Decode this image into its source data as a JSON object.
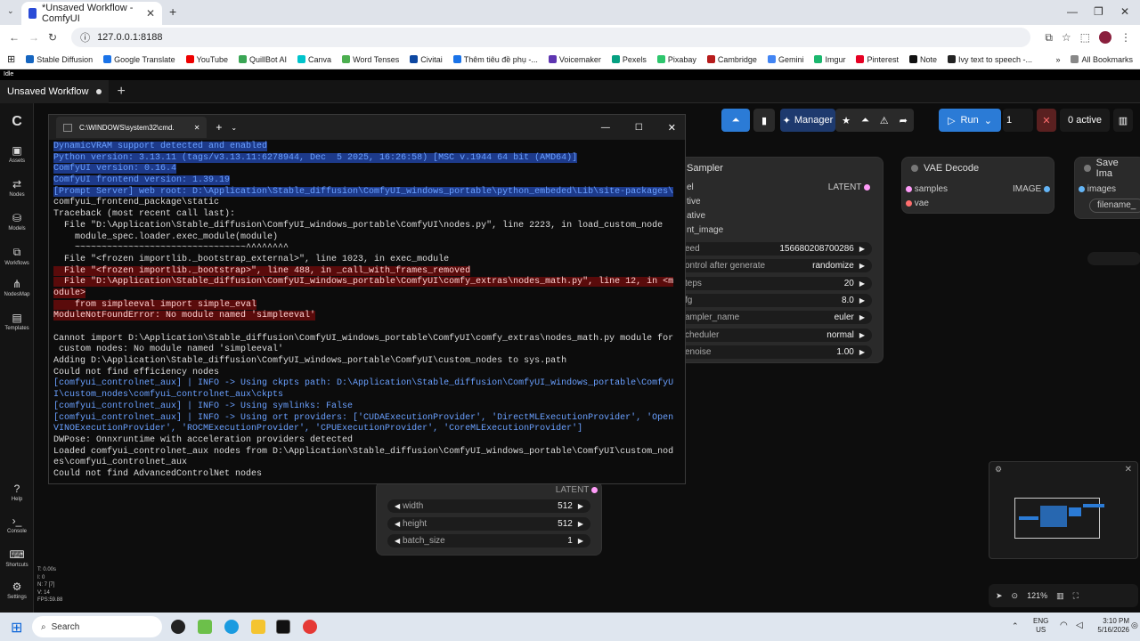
{
  "browser": {
    "tab_title": "*Unsaved Workflow - ComfyUI",
    "url": "127.0.0.1:8188",
    "bookmarks": [
      "Stable Diffusion",
      "Google Translate",
      "YouTube",
      "QuillBot AI",
      "Canva",
      "Word Tenses",
      "Civitai",
      "Thêm tiêu đề phụ -...",
      "Voicemaker",
      "Pexels",
      "Pixabay",
      "Cambridge",
      "Gemini",
      "Imgur",
      "Pinterest",
      "Note",
      "Ivy text to speech -..."
    ],
    "all_bookmarks": "All Bookmarks",
    "status": "Idle"
  },
  "comfy": {
    "workflow_tab": "Unsaved Workflow",
    "sidebar": [
      "Assets",
      "Nodes",
      "Models",
      "Workflows",
      "NodesMap",
      "Templates"
    ],
    "sidebar_bottom": [
      "Help",
      "Console",
      "Shortcuts",
      "Settings"
    ],
    "topbar": {
      "manager": "Manager",
      "run": "Run",
      "queue_count": "1",
      "active": "0 active"
    },
    "ksampler": {
      "title": "Sampler",
      "outputs": "LATENT",
      "inputs": [
        "el",
        "tive",
        "ative",
        "nt_image"
      ],
      "widgets": [
        {
          "label": "eed",
          "value": "156680208700286"
        },
        {
          "label": "ontrol after generate",
          "value": "randomize"
        },
        {
          "label": "teps",
          "value": "20"
        },
        {
          "label": "fg",
          "value": "8.0"
        },
        {
          "label": "ampler_name",
          "value": "euler"
        },
        {
          "label": "cheduler",
          "value": "normal"
        },
        {
          "label": "enoise",
          "value": "1.00"
        }
      ]
    },
    "vae_decode": {
      "title": "VAE Decode",
      "in1": "samples",
      "in2": "vae",
      "out": "IMAGE"
    },
    "save_image": {
      "title": "Save Ima",
      "in1": "images",
      "widget": "filename_"
    },
    "latent_node": {
      "out": "LATENT",
      "widgets": [
        {
          "label": "width",
          "value": "512"
        },
        {
          "label": "height",
          "value": "512"
        },
        {
          "label": "batch_size",
          "value": "1"
        }
      ]
    },
    "zoom": "121%",
    "stats": [
      "T: 0.00s",
      "I: 0",
      "N: 7 [7]",
      "V: 14",
      "FPS:59.88"
    ]
  },
  "terminal": {
    "title": "C:\\WINDOWS\\system32\\cmd.",
    "lines": [
      {
        "t": "DynamicVRAM support detected and enabled",
        "c": "blue",
        "s": "sel"
      },
      {
        "t": "Python version: 3.13.11 (tags/v3.13.11:6278944, Dec  5 2025, 16:26:58) [MSC v.1944 64 bit (AMD64)]",
        "c": "blue",
        "s": "sel"
      },
      {
        "t": "ComfyUI version: 0.16.4",
        "c": "blue",
        "s": "sel"
      },
      {
        "t": "ComfyUI frontend version: 1.39.19",
        "c": "blue",
        "s": "sel"
      },
      {
        "t": "[Prompt Server] web root: D:\\Application\\Stable_diffusion\\ComfyUI_windows_portable\\python_embeded\\Lib\\site-packages\\",
        "c": "blue",
        "s": "sel"
      },
      {
        "t": "comfyui_frontend_package\\static",
        "c": "",
        "s": ""
      },
      {
        "t": "Traceback (most recent call last):",
        "c": "",
        "s": ""
      },
      {
        "t": "  File \"D:\\Application\\Stable_diffusion\\ComfyUI_windows_portable\\ComfyUI\\nodes.py\", line 2223, in load_custom_node",
        "c": "",
        "s": ""
      },
      {
        "t": "    module_spec.loader.exec_module(module)",
        "c": "",
        "s": ""
      },
      {
        "t": "    ~~~~~~~~~~~~~~~~~~~~~~~~~~~~~~~~^^^^^^^^",
        "c": "",
        "s": ""
      },
      {
        "t": "  File \"<frozen importlib._bootstrap_external>\", line 1023, in exec_module",
        "c": "",
        "s": ""
      },
      {
        "t": "  File \"<frozen importlib._bootstrap>\", line 488, in _call_with_frames_removed",
        "c": "",
        "s": "err"
      },
      {
        "t": "  File \"D:\\Application\\Stable_diffusion\\ComfyUI_windows_portable\\ComfyUI\\comfy_extras\\nodes_math.py\", line 12, in <m",
        "c": "",
        "s": "err"
      },
      {
        "t": "odule>",
        "c": "",
        "s": "err"
      },
      {
        "t": "    from simpleeval import simple_eval",
        "c": "",
        "s": "err"
      },
      {
        "t": "ModuleNotFoundError: No module named 'simpleeval'",
        "c": "",
        "s": "err"
      },
      {
        "t": "",
        "c": "",
        "s": ""
      },
      {
        "t": "Cannot import D:\\Application\\Stable_diffusion\\ComfyUI_windows_portable\\ComfyUI\\comfy_extras\\nodes_math.py module for",
        "c": "",
        "s": ""
      },
      {
        "t": " custom nodes: No module named 'simpleeval'",
        "c": "",
        "s": ""
      },
      {
        "t": "Adding D:\\Application\\Stable_diffusion\\ComfyUI_windows_portable\\ComfyUI\\custom_nodes to sys.path",
        "c": "",
        "s": ""
      },
      {
        "t": "Could not find efficiency nodes",
        "c": "",
        "s": ""
      },
      {
        "t": "[comfyui_controlnet_aux] | INFO -> Using ckpts path: D:\\Application\\Stable_diffusion\\ComfyUI_windows_portable\\ComfyU",
        "c": "blue",
        "s": ""
      },
      {
        "t": "I\\custom_nodes\\comfyui_controlnet_aux\\ckpts",
        "c": "blue",
        "s": ""
      },
      {
        "t": "[comfyui_controlnet_aux] | INFO -> Using symlinks: False",
        "c": "blue",
        "s": ""
      },
      {
        "t": "[comfyui_controlnet_aux] | INFO -> Using ort providers: ['CUDAExecutionProvider', 'DirectMLExecutionProvider', 'Open",
        "c": "blue",
        "s": ""
      },
      {
        "t": "VINOExecutionProvider', 'ROCMExecutionProvider', 'CPUExecutionProvider', 'CoreMLExecutionProvider']",
        "c": "blue",
        "s": ""
      },
      {
        "t": "DWPose: Onnxruntime with acceleration providers detected",
        "c": "",
        "s": ""
      },
      {
        "t": "Loaded comfyui_controlnet_aux nodes from D:\\Application\\Stable_diffusion\\ComfyUI_windows_portable\\ComfyUI\\custom_nod",
        "c": "",
        "s": ""
      },
      {
        "t": "es\\comfyui_controlnet_aux",
        "c": "",
        "s": ""
      },
      {
        "t": "Could not find AdvancedControlNet nodes",
        "c": "",
        "s": ""
      }
    ]
  },
  "taskbar": {
    "search": "Search",
    "lang": "ENG",
    "region": "US",
    "time": "3:10 PM",
    "date": "5/16/2026"
  },
  "colors": {
    "accent": "#2b7bd6",
    "latent": "#ff9cf9",
    "vae": "#ff6e6e",
    "image": "#64b5f6"
  }
}
